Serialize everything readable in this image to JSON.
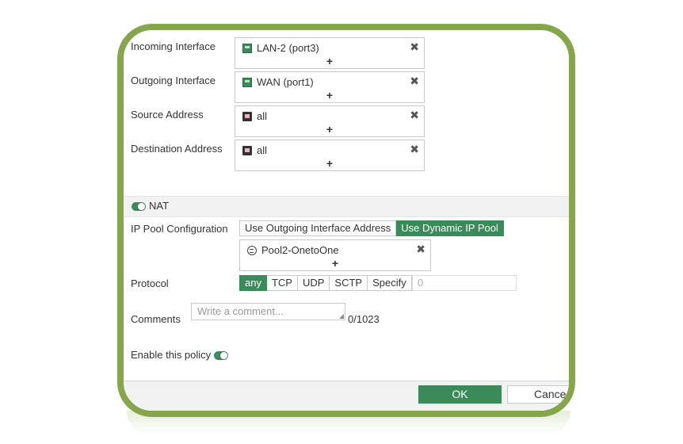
{
  "form": {
    "incoming_interface": {
      "label": "Incoming Interface",
      "value": "LAN-2 (port3)",
      "icon": "interface-icon"
    },
    "outgoing_interface": {
      "label": "Outgoing Interface",
      "value": "WAN (port1)",
      "icon": "interface-icon"
    },
    "source_address": {
      "label": "Source Address",
      "value": "all",
      "icon": "address-icon"
    },
    "destination_address": {
      "label": "Destination Address",
      "value": "all",
      "icon": "address-icon"
    },
    "add_symbol": "+",
    "remove_symbol": "✖"
  },
  "nat": {
    "label": "NAT",
    "enabled": true
  },
  "ip_pool": {
    "label": "IP Pool Configuration",
    "options": [
      "Use Outgoing Interface Address",
      "Use Dynamic IP Pool"
    ],
    "selected": "Use Dynamic IP Pool",
    "pool_value": "Pool2-OnetoOne",
    "pool_icon": "ip-pool-icon"
  },
  "protocol": {
    "label": "Protocol",
    "options": [
      "any",
      "TCP",
      "UDP",
      "SCTP",
      "Specify"
    ],
    "selected": "any",
    "number_value": "0"
  },
  "comments": {
    "label": "Comments",
    "placeholder": "Write a comment...",
    "counter": "0/1023"
  },
  "enable_policy": {
    "label": "Enable this policy",
    "enabled": true
  },
  "footer": {
    "ok_label": "OK",
    "cancel_label": "Cance"
  },
  "colors": {
    "frame": "#86a64b",
    "accent": "#3b8b5a"
  }
}
